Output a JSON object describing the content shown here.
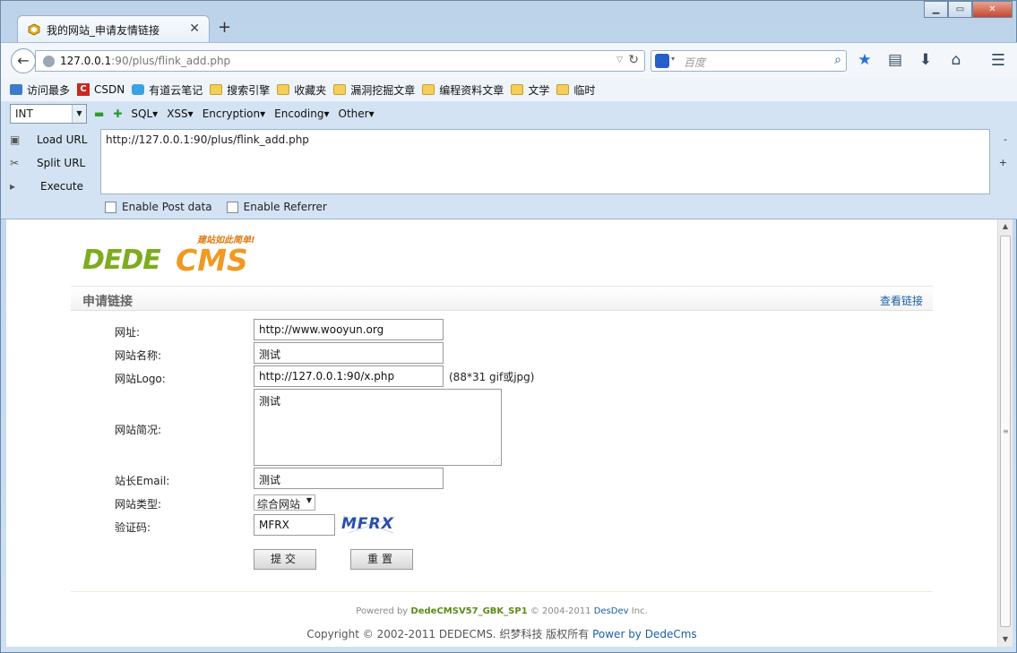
{
  "browser": {
    "tab_title": "我的网站_申请友情链接",
    "new_tab": "+",
    "window_controls": [
      "▁",
      "▭",
      "✕"
    ],
    "url_host": "127.0.0.1",
    "url_rest": ":90/plus/flink_add.php",
    "search_placeholder": "百度",
    "nav_icons": [
      "star-icon",
      "reading-list-icon",
      "download-icon",
      "home-icon",
      "menu-icon"
    ]
  },
  "bookmarks": [
    {
      "label": "访问最多",
      "icon": "most-visited-icon"
    },
    {
      "label": "CSDN",
      "icon": "csdn-icon"
    },
    {
      "label": "有道云笔记",
      "icon": "youdao-icon"
    },
    {
      "label": "搜索引擎",
      "icon": "folder-icon"
    },
    {
      "label": "收藏夹",
      "icon": "folder-icon"
    },
    {
      "label": "漏洞挖掘文章",
      "icon": "folder-icon"
    },
    {
      "label": "编程资料文章",
      "icon": "folder-icon"
    },
    {
      "label": "文学",
      "icon": "folder-icon"
    },
    {
      "label": "临时",
      "icon": "folder-icon"
    }
  ],
  "hackbar": {
    "select_value": "INT",
    "menu": [
      "SQL",
      "XSS",
      "Encryption",
      "Encoding",
      "Other"
    ],
    "actions": [
      "Load URL",
      "Split URL",
      "Execute"
    ],
    "url_value": "http://127.0.0.1:90/plus/flink_add.php",
    "side_minus": "-",
    "side_plus": "+",
    "enable_post": "Enable Post data",
    "enable_referrer": "Enable Referrer"
  },
  "page": {
    "logo_slogan": "建站如此简单!",
    "logo_dede": "DEDE",
    "logo_cms": "CMS",
    "section_title": "申请链接",
    "section_link": "查看链接",
    "form": {
      "url_label": "网址:",
      "url_value": "http://www.wooyun.org",
      "name_label": "网站名称:",
      "name_value": "测试",
      "logo_label": "网站Logo:",
      "logo_value": "http://127.0.0.1:90/x.php",
      "logo_hint": "(88*31 gif或jpg)",
      "desc_label": "网站简况:",
      "desc_value": "测试",
      "email_label": "站长Email:",
      "email_value": "测试",
      "type_label": "网站类型:",
      "type_value": "综合网站",
      "captcha_label": "验证码:",
      "captcha_value": "MFRX",
      "captcha_image_text": "MFRX",
      "submit_label": "提交",
      "reset_label": "重置"
    },
    "powered_prefix": "Powered by",
    "powered_version": "DedeCMSV57_GBK_SP1",
    "powered_years": "© 2004-2011",
    "powered_company": "DesDev",
    "powered_suffix": "Inc.",
    "copyright_text": "Copyright © 2002-2011 DEDECMS. 织梦科技 版权所有",
    "copyright_link": "Power by DedeCms"
  }
}
